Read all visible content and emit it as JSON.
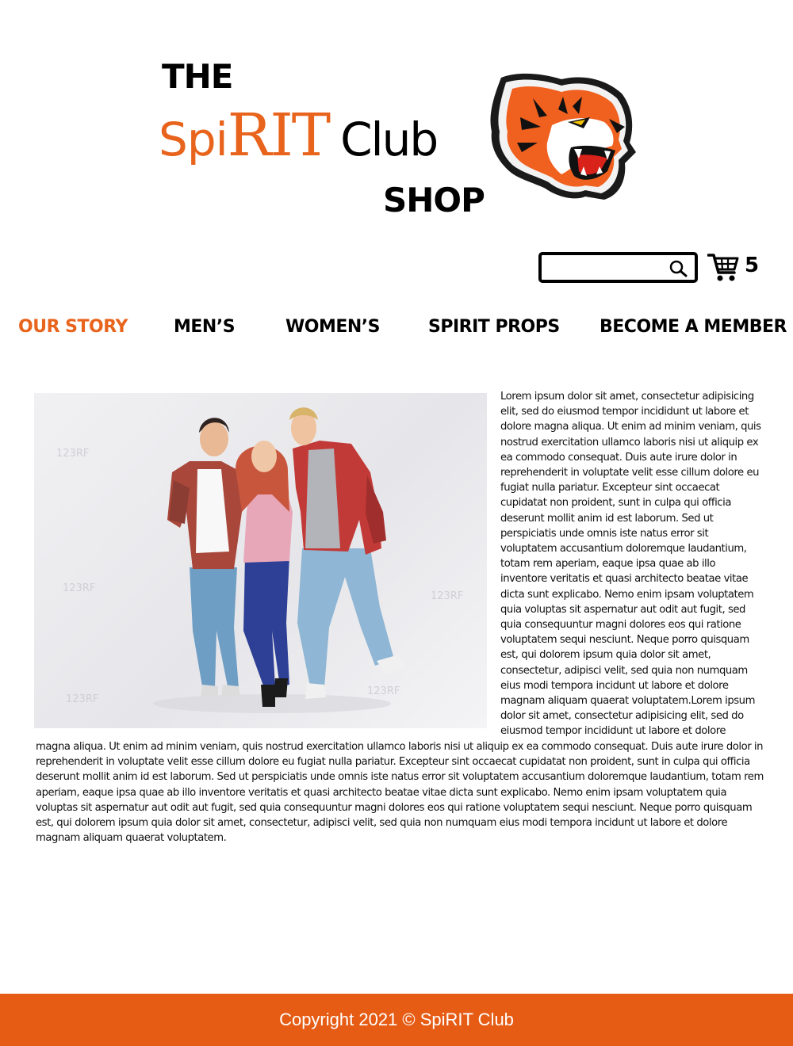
{
  "logo": {
    "the": "THE",
    "spi": "Spi",
    "rit": "RIT",
    "club": "Club",
    "shop": "SHOP",
    "mascot_icon": "tiger-head-icon"
  },
  "search": {
    "value": "",
    "placeholder": "",
    "icon": "search-icon"
  },
  "cart": {
    "icon": "shopping-cart-icon",
    "count": "5"
  },
  "nav": {
    "items": [
      {
        "label": "OUR STORY",
        "active": true
      },
      {
        "label": "MEN’S",
        "active": false
      },
      {
        "label": "WOMEN’S",
        "active": false
      },
      {
        "label": "SPIRIT PROPS",
        "active": false
      },
      {
        "label": "BECOME A MEMBER",
        "active": false
      }
    ]
  },
  "story": {
    "image_icon": "group-photo",
    "watermark": "123RF",
    "right_text": "Lorem ipsum dolor sit amet, consectetur adipisicing elit, sed do eiusmod tempor incididunt ut labore et dolore magna aliqua. Ut enim ad minim veniam, quis nostrud exercitation ullamco laboris nisi ut aliquip ex ea commodo consequat. Duis aute irure dolor in reprehenderit in voluptate velit esse cillum dolore eu fugiat nulla pariatur. Excepteur sint occaecat cupidatat non proident, sunt in culpa qui officia deserunt mollit anim id est laborum. Sed ut perspiciatis unde omnis iste natus error sit voluptatem accusantium doloremque laudantium, totam rem aperiam, eaque ipsa quae ab illo inventore veritatis et quasi architecto beatae vitae dicta sunt explicabo. Nemo enim ipsam voluptatem quia voluptas sit aspernatur aut odit aut fugit, sed quia consequuntur magni dolores eos qui ratione voluptatem sequi nesciunt. Neque porro quisquam est, qui dolorem ipsum quia dolor sit amet, consectetur, adipisci velit, sed quia non numquam eius modi tempora incidunt ut labore et dolore magnam aliquam quaerat voluptatem.Lorem ipsum dolor sit amet, consectetur adipisicing elit, sed do eiusmod tempor incididunt ut labore et dolore",
    "bottom_text": "magna aliqua. Ut enim ad minim veniam, quis nostrud exercitation ullamco laboris nisi ut aliquip ex ea commodo consequat. Duis aute irure dolor in reprehenderit in voluptate velit esse cillum dolore eu fugiat nulla pariatur. Excepteur sint occaecat cupidatat non proident, sunt in culpa qui officia deserunt mollit anim id est laborum. Sed ut perspiciatis unde omnis iste natus error sit voluptatem accusantium doloremque laudantium, totam rem aperiam, eaque ipsa quae ab illo inventore veritatis et quasi architecto beatae vitae dicta sunt explicabo. Nemo enim ipsam voluptatem quia voluptas sit aspernatur aut odit aut fugit, sed quia consequuntur magni dolores eos qui ratione voluptatem sequi nesciunt. Neque porro quisquam est, qui dolorem ipsum quia dolor sit amet, consectetur, adipisci velit, sed quia non numquam eius modi tempora incidunt ut labore et dolore magnam aliquam quaerat voluptatem."
  },
  "footer": {
    "copyright": "Copyright 2021 © SpiRIT Club"
  },
  "colors": {
    "accent": "#e8631c",
    "footer_bg": "#e65c14",
    "text": "#000000",
    "background": "#ffffff"
  }
}
